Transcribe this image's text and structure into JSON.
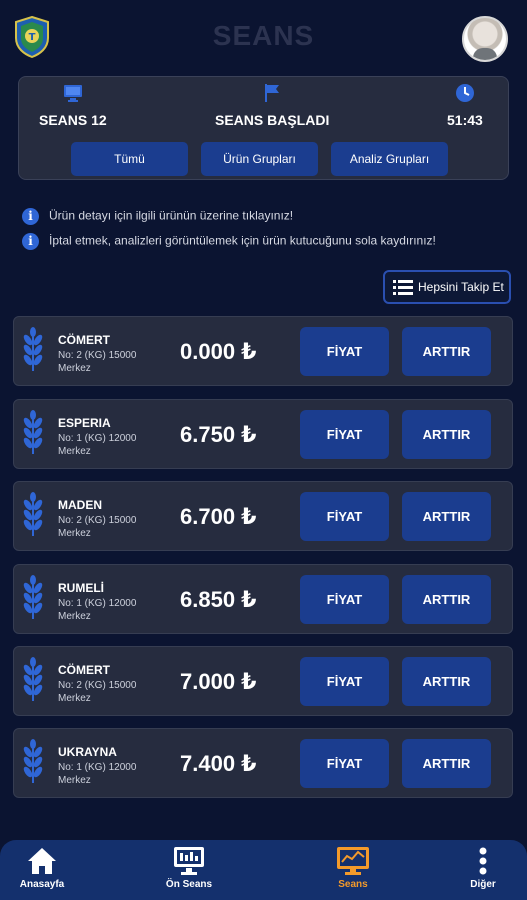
{
  "header": {
    "title": "SEANS",
    "logo_icon": "shield-logo-icon",
    "avatar_icon": "user-avatar"
  },
  "session": {
    "name": "SEANS 12",
    "status": "SEANS BAŞLADI",
    "time": "51:43",
    "tabs": [
      {
        "label": "Tümü"
      },
      {
        "label": "Ürün Grupları"
      },
      {
        "label": "Analiz Grupları"
      }
    ]
  },
  "info": {
    "line1": "Ürün detayı için ilgili ürünün üzerine tıklayınız!",
    "line2": "İptal etmek, analizleri görüntülemek için ürün kutucuğunu sola kaydırınız!"
  },
  "follow_all_label": "Hepsini Takip Et",
  "products": [
    {
      "name": "CÖMERT",
      "detail": "No: 2 (KG) 15000",
      "location": "Merkez",
      "price": "0.000 ₺",
      "price_label": "FİYAT",
      "raise_label": "ARTTIR"
    },
    {
      "name": "ESPERIA",
      "detail": "No: 1 (KG) 12000",
      "location": "Merkez",
      "price": "6.750 ₺",
      "price_label": "FİYAT",
      "raise_label": "ARTTIR"
    },
    {
      "name": "MADEN",
      "detail": "No: 2 (KG) 15000",
      "location": "Merkez",
      "price": "6.700 ₺",
      "price_label": "FİYAT",
      "raise_label": "ARTTIR"
    },
    {
      "name": "RUMELİ",
      "detail": "No: 1 (KG) 12000",
      "location": "Merkez",
      "price": "6.850 ₺",
      "price_label": "FİYAT",
      "raise_label": "ARTTIR"
    },
    {
      "name": "CÖMERT",
      "detail": "No: 2 (KG) 15000",
      "location": "Merkez",
      "price": "7.000 ₺",
      "price_label": "FİYAT",
      "raise_label": "ARTTIR"
    },
    {
      "name": "UKRAYNA",
      "detail": "No: 1 (KG) 12000",
      "location": "Merkez",
      "price": "7.400 ₺",
      "price_label": "FİYAT",
      "raise_label": "ARTTIR"
    }
  ],
  "nav": [
    {
      "label": "Anasayfa",
      "icon": "home-icon"
    },
    {
      "label": "Ön Seans",
      "icon": "monitor-icon"
    },
    {
      "label": "Seans",
      "icon": "chart-monitor-icon",
      "active": true
    },
    {
      "label": "Diğer",
      "icon": "more-vertical-icon"
    }
  ],
  "colors": {
    "background": "#0b1431",
    "card": "#262c3f",
    "button": "#1b3d8f",
    "nav_bar": "#14306d",
    "active_nav": "#f39a2b",
    "info_icon": "#2f66d6"
  }
}
